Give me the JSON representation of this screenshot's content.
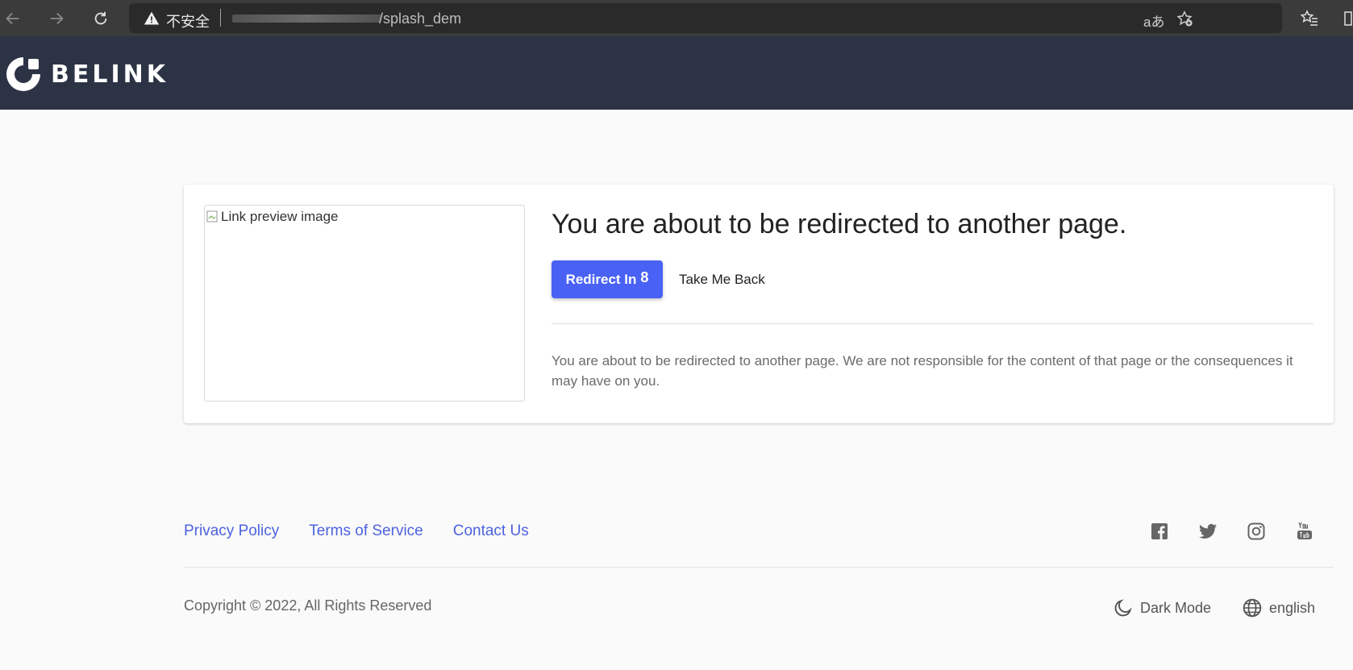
{
  "browser": {
    "insecure_label": "不安全",
    "url_visible": "/splash_dem",
    "translate_label": "aあ"
  },
  "header": {
    "logo_text": "BELINK"
  },
  "card": {
    "image_alt": "Link preview image",
    "title": "You are about to be redirected to another page.",
    "redirect_label": "Redirect In",
    "redirect_count": "8",
    "back_label": "Take Me Back",
    "description": "You are about to be redirected to another page. We are not responsible for the content of that page or the consequences it may have on you."
  },
  "footer": {
    "links": [
      "Privacy Policy",
      "Terms of Service",
      "Contact Us"
    ],
    "social": [
      "facebook-icon",
      "twitter-icon",
      "instagram-icon",
      "youtube-icon"
    ],
    "copyright": "Copyright © 2022, All Rights Reserved",
    "dark_mode_label": "Dark Mode",
    "language_label": "english"
  },
  "colors": {
    "header_bg": "#2c3345",
    "primary": "#4962f5",
    "link": "#4d62e0",
    "page_bg": "#fafafa"
  }
}
